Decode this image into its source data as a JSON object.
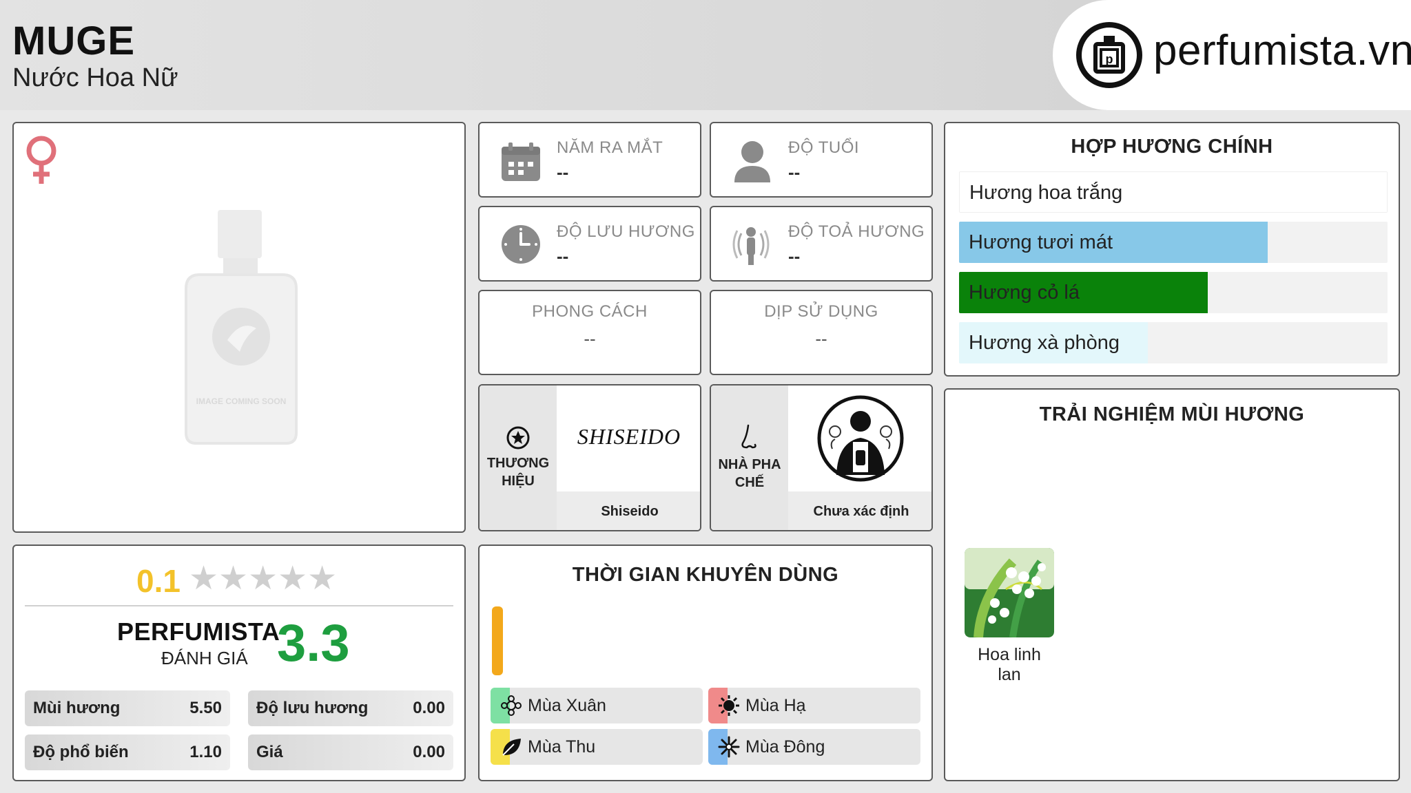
{
  "header": {
    "title": "MUGE",
    "subtitle": "Nước Hoa Nữ",
    "site": "perfumista.vn"
  },
  "product_image": {
    "caption": "IMAGE COMING SOON",
    "gender_icon": "female-icon"
  },
  "info_cards": {
    "release_year": {
      "label": "NĂM RA MẮT",
      "value": "--"
    },
    "age": {
      "label": "ĐỘ TUỔI",
      "value": "--"
    },
    "longevity": {
      "label": "ĐỘ LƯU HƯƠNG",
      "value": "--"
    },
    "sillage": {
      "label": "ĐỘ TOẢ HƯƠNG",
      "value": "--"
    },
    "style": {
      "label": "PHONG CÁCH",
      "value": "--"
    },
    "occasion": {
      "label": "DỊP SỬ DỤNG",
      "value": "--"
    }
  },
  "brand": {
    "label_line1": "THƯƠNG",
    "label_line2": "HIỆU",
    "logo_text": "SHISEIDO",
    "name": "Shiseido"
  },
  "perfumer": {
    "label_line1": "NHÀ PHA",
    "label_line2": "CHẾ",
    "name": "Chưa xác định"
  },
  "accords": {
    "title": "HỢP HƯƠNG CHÍNH",
    "items": [
      {
        "label": "Hương hoa trắng",
        "fill": 1.0,
        "color": "#ffffff"
      },
      {
        "label": "Hương tươi mát",
        "fill": 0.72,
        "color": "#87c8e8"
      },
      {
        "label": "Hương cỏ lá",
        "fill": 0.58,
        "color": "#0a820a"
      },
      {
        "label": "Hương xà phòng",
        "fill": 0.44,
        "color": "#e3f7fb"
      }
    ]
  },
  "rating": {
    "user_score": "0.1",
    "stars_filled": 0.1,
    "brand_line1": "PERFUMISTA",
    "brand_line2": "ĐÁNH GIÁ",
    "score": "3.3",
    "stats": [
      {
        "label": "Mùi hương",
        "value": "5.50"
      },
      {
        "label": "Độ lưu hương",
        "value": "0.00"
      },
      {
        "label": "Độ phổ biến",
        "value": "1.10"
      },
      {
        "label": "Giá",
        "value": "0.00"
      }
    ]
  },
  "timing": {
    "title": "THỜI GIAN KHUYÊN DÙNG",
    "seasons": [
      {
        "label": "Mùa Xuân",
        "color": "#7ee0a3",
        "icon": "spring-icon"
      },
      {
        "label": "Mùa Hạ",
        "color": "#f08a8a",
        "icon": "sun-icon"
      },
      {
        "label": "Mùa Thu",
        "color": "#f5e04a",
        "icon": "leaf-icon"
      },
      {
        "label": "Mùa Đông",
        "color": "#7fb8ee",
        "icon": "snowflake-icon"
      }
    ],
    "day_bar_color": "#f3a81b"
  },
  "experience": {
    "title": "TRẢI NGHIỆM MÙI HƯƠNG",
    "notes": [
      {
        "label": "Hoa linh lan"
      }
    ]
  },
  "colors": {
    "score_green": "#1e9e3f",
    "user_score_yellow": "#f3c22a",
    "female_pink": "#e0707a"
  }
}
